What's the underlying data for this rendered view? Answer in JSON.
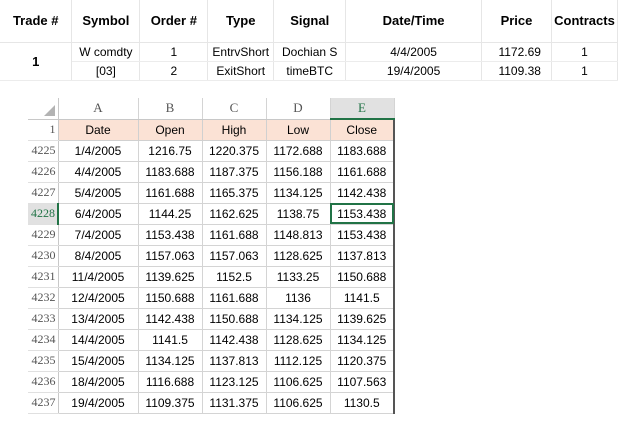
{
  "trade_report": {
    "headers": [
      "Trade #",
      "Symbol",
      "Order #",
      "Type",
      "Signal",
      "Date/Time",
      "Price",
      "Contracts"
    ],
    "trade_number": "1",
    "symbol_line1": "W comdty",
    "symbol_line2": "[03]",
    "orders": [
      {
        "order": "1",
        "type": "EntrvShort",
        "signal": "Dochian S",
        "datetime": "4/4/2005",
        "price": "1172.69",
        "contracts": "1"
      },
      {
        "order": "2",
        "type": "ExitShort",
        "signal": "timeBTC",
        "datetime": "19/4/2005",
        "price": "1109.38",
        "contracts": "1"
      }
    ]
  },
  "sheet": {
    "column_letters": [
      "A",
      "B",
      "C",
      "D",
      "E"
    ],
    "selected_column": "E",
    "header_row_number": "1",
    "headers": [
      "Date",
      "Open",
      "High",
      "Low",
      "Close"
    ],
    "selected_row": "4228",
    "rows": [
      {
        "row": "4225",
        "cells": [
          "1/4/2005",
          "1216.75",
          "1220.375",
          "1172.688",
          "1183.688"
        ]
      },
      {
        "row": "4226",
        "cells": [
          "4/4/2005",
          "1183.688",
          "1187.375",
          "1156.188",
          "1161.688"
        ]
      },
      {
        "row": "4227",
        "cells": [
          "5/4/2005",
          "1161.688",
          "1165.375",
          "1134.125",
          "1142.438"
        ]
      },
      {
        "row": "4228",
        "cells": [
          "6/4/2005",
          "1144.25",
          "1162.625",
          "1138.75",
          "1153.438"
        ]
      },
      {
        "row": "4229",
        "cells": [
          "7/4/2005",
          "1153.438",
          "1161.688",
          "1148.813",
          "1153.438"
        ]
      },
      {
        "row": "4230",
        "cells": [
          "8/4/2005",
          "1157.063",
          "1157.063",
          "1128.625",
          "1137.813"
        ]
      },
      {
        "row": "4231",
        "cells": [
          "11/4/2005",
          "1139.625",
          "1152.5",
          "1133.25",
          "1150.688"
        ]
      },
      {
        "row": "4232",
        "cells": [
          "12/4/2005",
          "1150.688",
          "1161.688",
          "1136",
          "1141.5"
        ]
      },
      {
        "row": "4233",
        "cells": [
          "13/4/2005",
          "1142.438",
          "1150.688",
          "1134.125",
          "1139.625"
        ]
      },
      {
        "row": "4234",
        "cells": [
          "14/4/2005",
          "1141.5",
          "1142.438",
          "1128.625",
          "1134.125"
        ]
      },
      {
        "row": "4235",
        "cells": [
          "15/4/2005",
          "1134.125",
          "1137.813",
          "1112.125",
          "1120.375"
        ]
      },
      {
        "row": "4236",
        "cells": [
          "18/4/2005",
          "1116.688",
          "1123.125",
          "1106.625",
          "1107.563"
        ]
      },
      {
        "row": "4237",
        "cells": [
          "19/4/2005",
          "1109.375",
          "1131.375",
          "1106.625",
          "1130.5"
        ]
      }
    ]
  },
  "colors": {
    "accent": "#217346",
    "header_fill": "#fbe2d5"
  }
}
